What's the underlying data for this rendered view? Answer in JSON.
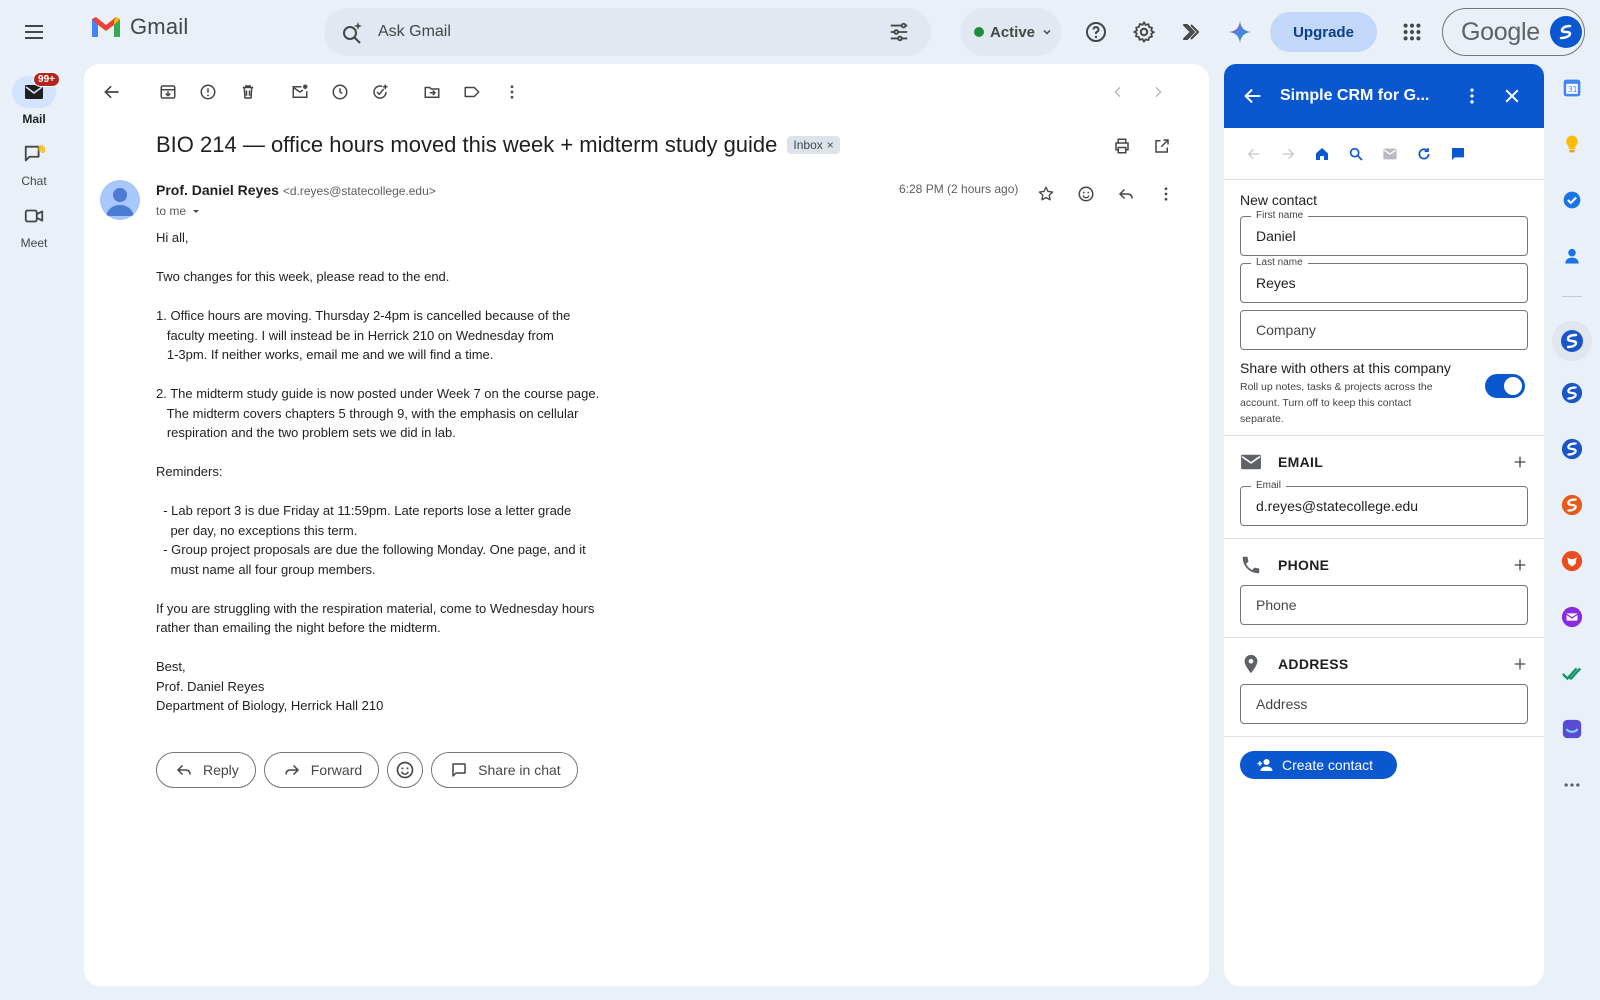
{
  "app": {
    "name": "Gmail",
    "brand_red": "#ea4335",
    "accent": "#0b57d0"
  },
  "search": {
    "placeholder": "Ask Gmail"
  },
  "status": {
    "label": "Active",
    "color": "#1e8e3e"
  },
  "header": {
    "upgrade_label": "Upgrade",
    "account_word": "Google"
  },
  "rail": {
    "items": [
      {
        "label": "Mail",
        "badge": "99+",
        "icon": "mail-icon"
      },
      {
        "label": "Chat",
        "icon": "chat-icon"
      },
      {
        "label": "Meet",
        "icon": "video-icon"
      }
    ]
  },
  "email": {
    "subject": "BIO 214 — office hours moved this week + midterm study guide",
    "label_chip": "Inbox",
    "sender_name": "Prof. Daniel Reyes",
    "sender_email": "<d.reyes@statecollege.edu>",
    "to": "to me",
    "time": "6:28 PM (2 hours ago)",
    "body_lines": [
      "Hi all,",
      "",
      "Two changes for this week, please read to the end.",
      "",
      "1. Office hours are moving. Thursday 2-4pm is cancelled because of the",
      "   faculty meeting. I will instead be in Herrick 210 on Wednesday from",
      "   1-3pm. If neither works, email me and we will find a time.",
      "",
      "2. The midterm study guide is now posted under Week 7 on the course page.",
      "   The midterm covers chapters 5 through 9, with the emphasis on cellular",
      "   respiration and the two problem sets we did in lab.",
      "",
      "Reminders:",
      "",
      "  - Lab report 3 is due Friday at 11:59pm. Late reports lose a letter grade",
      "    per day, no exceptions this term.",
      "  - Group project proposals are due the following Monday. One page, and it",
      "    must name all four group members.",
      "",
      "If you are struggling with the respiration material, come to Wednesday hours",
      "rather than emailing the night before the midterm.",
      "",
      "Best,",
      "Prof. Daniel Reyes",
      "Department of Biology, Herrick Hall 210"
    ],
    "actions": {
      "reply": "Reply",
      "forward": "Forward",
      "share": "Share in chat"
    }
  },
  "crm": {
    "title": "Simple CRM for G...",
    "section_title": "New contact",
    "first_name": {
      "label": "First name",
      "value": "Daniel"
    },
    "last_name": {
      "label": "Last name",
      "value": "Reyes"
    },
    "company": {
      "placeholder": "Company"
    },
    "share": {
      "title": "Share with others at this company",
      "desc": "Roll up notes, tasks & projects across the account. Turn off to keep this contact separate.",
      "enabled": true
    },
    "email_section": {
      "title": "EMAIL",
      "field_label": "Email",
      "value": "d.reyes@statecollege.edu"
    },
    "phone_section": {
      "title": "PHONE",
      "placeholder": "Phone"
    },
    "address_section": {
      "title": "ADDRESS",
      "placeholder": "Address"
    },
    "create_label": "Create contact"
  }
}
